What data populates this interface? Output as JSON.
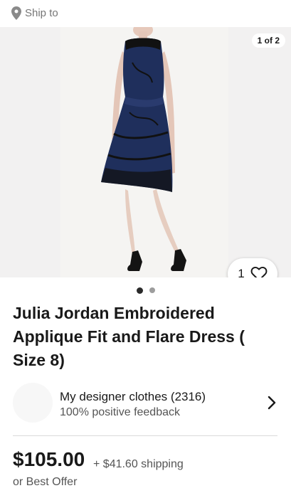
{
  "header": {
    "ship_to": "Ship to"
  },
  "gallery": {
    "counter": "1 of 2",
    "watch_count": "1",
    "image_alt": "Navy and black lace sleeveless dress"
  },
  "listing": {
    "title": "Julia Jordan Embroidered Applique Fit and Flare Dress ( Size 8)",
    "price": "$105.00",
    "shipping": "+ $41.60 shipping",
    "offer": "or Best Offer"
  },
  "seller": {
    "name": "My designer clothes (2316)",
    "feedback": "100% positive feedback"
  },
  "colors": {
    "dress_navy": "#1f2f5c",
    "dress_black": "#111111",
    "skin": "#e8cfc2",
    "background": "#f2f1f1"
  },
  "icons": {
    "location": "location-pin-icon",
    "heart": "heart-icon",
    "chevron": "chevron-right-icon"
  }
}
